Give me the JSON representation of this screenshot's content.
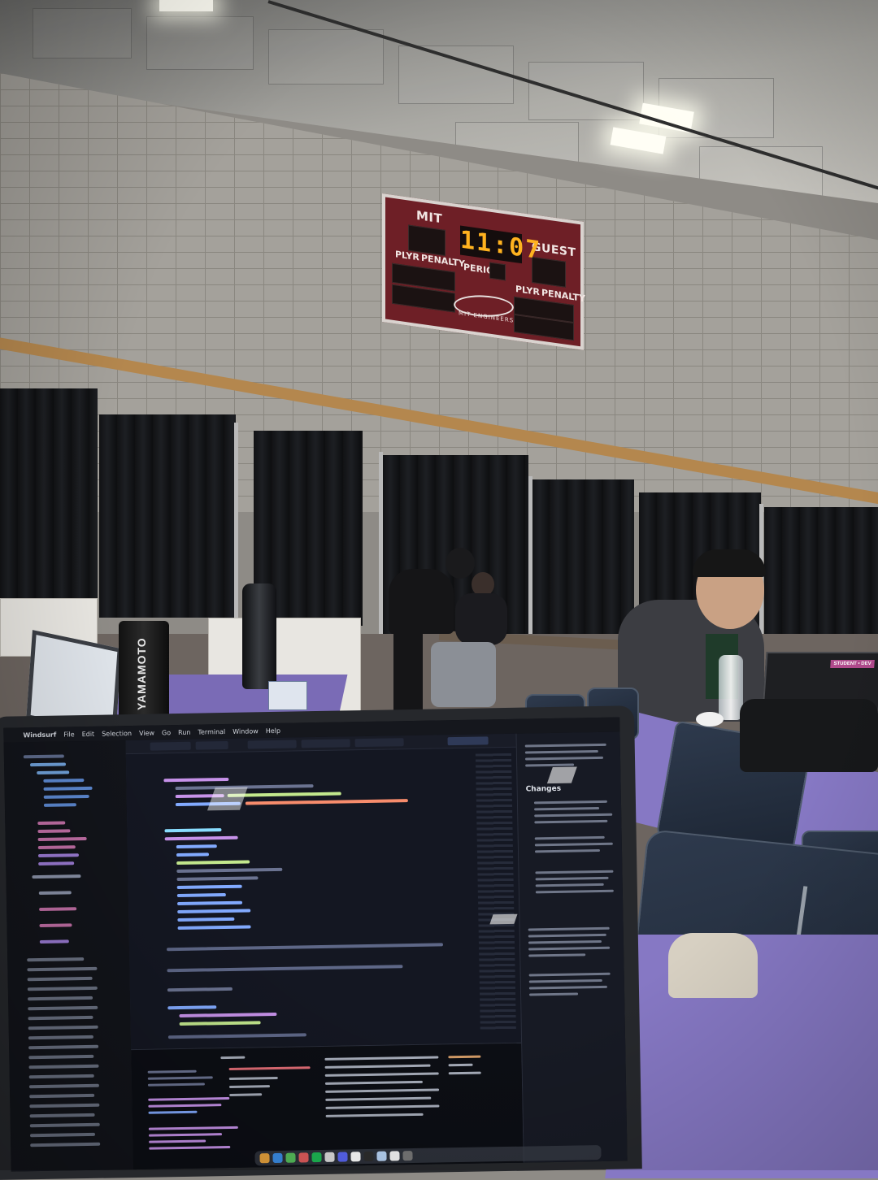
{
  "scoreboard": {
    "home": "MIT",
    "guest": "GUEST",
    "clock": "11:07",
    "period": "PERIOD",
    "left_plyr": "PLYR",
    "left_penalty": "PENALTY",
    "right_plyr": "PLYR",
    "right_penalty": "PENALTY",
    "brand": "MIT ENGINEERS"
  },
  "tumbler": {
    "brand": "YAMAMOTO"
  },
  "laptop": {
    "menubar": {
      "app": "Windsurf",
      "items": [
        "File",
        "Edit",
        "Selection",
        "View",
        "Go",
        "Run",
        "Terminal",
        "Window",
        "Help"
      ]
    },
    "panel_heading": "Changes"
  },
  "sticker": {
    "text": "STUDENT • DEV"
  },
  "colors": {
    "table_purple": "#7a6bb6",
    "scoreboard_red": "#6e1f26",
    "clock_amber": "#ffb21f"
  }
}
